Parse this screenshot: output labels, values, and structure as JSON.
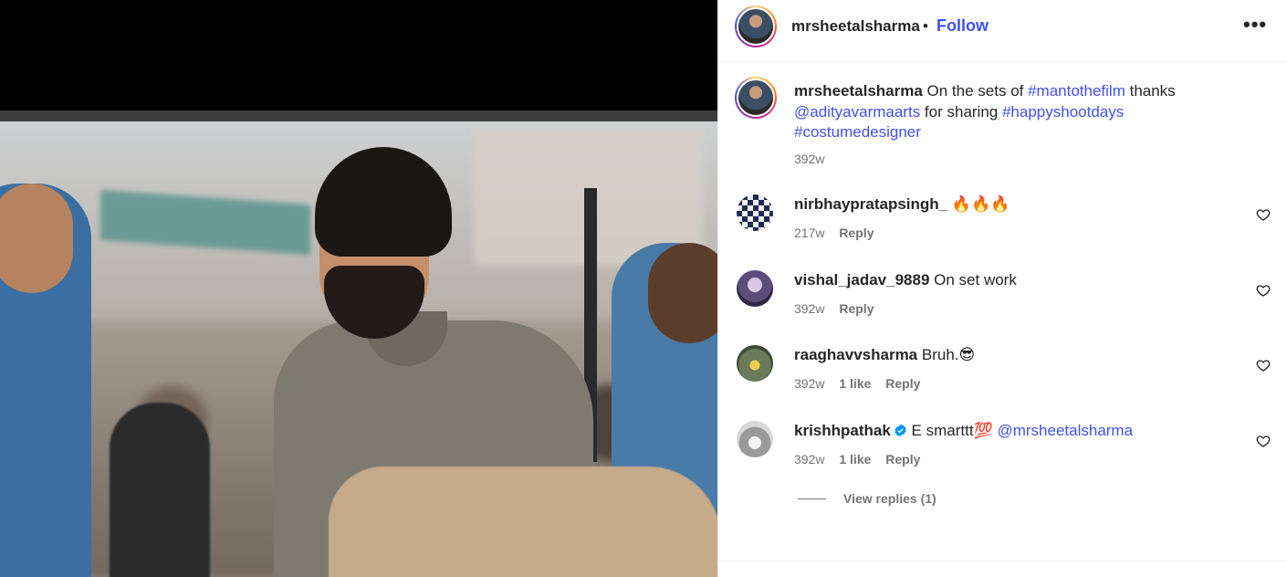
{
  "post": {
    "author": "mrsheetalsharma",
    "dot": "•",
    "follow_label": "Follow",
    "more_icon": "more-horizontal-icon"
  },
  "caption": {
    "username": "mrsheetalsharma",
    "text_1": " On the sets of ",
    "tag_1": "#mantothefilm",
    "text_2": " thanks ",
    "mention_1": "@adityavarmaarts",
    "text_3": " for sharing ",
    "tag_2": "#happyshootdays",
    "tag_3": "#costumedesigner",
    "time": "392w"
  },
  "comments": [
    {
      "username": "nirbhaypratapsingh_",
      "text": "🔥🔥🔥",
      "time": "217w",
      "likes": "",
      "reply_label": "Reply",
      "verified": false
    },
    {
      "username": "vishal_jadav_9889",
      "text": "On set work",
      "time": "392w",
      "likes": "",
      "reply_label": "Reply",
      "verified": false
    },
    {
      "username": "raaghavvsharma",
      "text": "Bruh.😎",
      "time": "392w",
      "likes": "1 like",
      "reply_label": "Reply",
      "verified": false
    },
    {
      "username": "krishhpathak",
      "text": "E smarttt💯",
      "mention": "@mrsheetalsharma",
      "time": "392w",
      "likes": "1 like",
      "reply_label": "Reply",
      "verified": true
    }
  ],
  "view_replies_label": "View replies (1)",
  "colors": {
    "link": "#4150f7",
    "muted": "#737373",
    "text": "#262626",
    "verified": "#0095f6"
  }
}
